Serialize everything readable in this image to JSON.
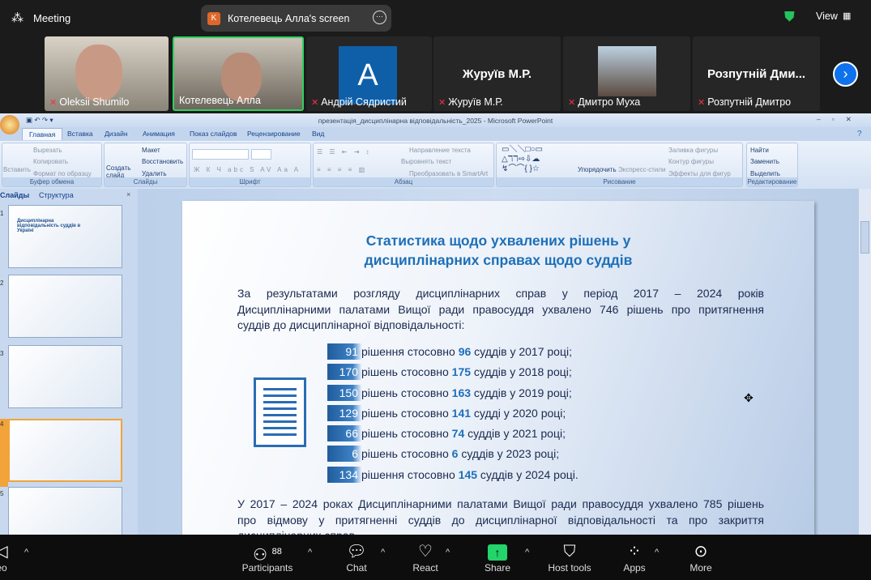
{
  "zoom": {
    "meeting_label": "Meeting",
    "share_pill": {
      "initial": "K",
      "label": "Котелевець Алла's screen"
    },
    "view_label": "View",
    "participants": [
      {
        "name": "Oleksii Shumilo",
        "video": true
      },
      {
        "name": "Котелевець Алла",
        "video": true,
        "active": true
      },
      {
        "name": "Андрій Сядристий",
        "avatar_letter": "A"
      },
      {
        "name": "Журуїв М.Р.",
        "display": "Журуїв М.Р."
      },
      {
        "name": "Дмитро Муха",
        "video": true
      },
      {
        "name": "Розпутній Дмитро",
        "display": "Розпутній Дми..."
      }
    ],
    "toolbar": {
      "video_label": "eo",
      "participants_label": "Participants",
      "participants_count": "88",
      "chat": "Chat",
      "react": "React",
      "share": "Share",
      "host_tools": "Host tools",
      "apps": "Apps",
      "more": "More"
    },
    "colors": {
      "share_green": "#22d46a",
      "accent_blue": "#0e72ed"
    }
  },
  "ppt": {
    "window_title": "презентація_дисциплінарна відповідальність_2025 - Microsoft PowerPoint",
    "tabs": [
      "Главная",
      "Вставка",
      "Дизайн",
      "Анимация",
      "Показ слайдов",
      "Рецензирование",
      "Вид"
    ],
    "ribbon": {
      "clipboard": {
        "label": "Буфер обмена",
        "paste": "Вставить",
        "cut": "Вырезать",
        "copy": "Копировать",
        "format": "Формат по образцу"
      },
      "slides": {
        "label": "Слайды",
        "new": "Создать слайд",
        "layout": "Макет",
        "reset": "Восстановить",
        "delete": "Удалить"
      },
      "font": {
        "label": "Шрифт"
      },
      "paragraph": {
        "label": "Абзац",
        "direction": "Направление текста",
        "align": "Выровнять текст",
        "smartart": "Преобразовать в SmartArt"
      },
      "drawing": {
        "label": "Рисование",
        "arrange": "Упорядочить",
        "styles": "Экспресс-стили",
        "fill": "Заливка фигуры",
        "outline": "Контур фигуры",
        "effects": "Эффекты для фигур"
      },
      "editing": {
        "label": "Редактирование",
        "find": "Найти",
        "replace": "Заменить",
        "select": "Выделить"
      }
    },
    "panel": {
      "tab_slides": "Слайды",
      "tab_outline": "Структура",
      "numbers": [
        "1",
        "2",
        "3",
        "4",
        "5"
      ],
      "thumb1_title": "Дисциплінарна відповідальність суддів в Україні"
    },
    "slide": {
      "title_line1": "Статистика щодо ухвалених рішень у",
      "title_line2": "дисциплінарних справах щодо суддів",
      "intro_lines": [
        "За результатами розгляду дисциплінарних справ у період 2017 – 2024 років",
        "Дисциплінарними палатами Вищої ради правосуддя ухвалено 746 рішень про притягнення",
        "суддів до дисциплінарної відповідальності:"
      ],
      "items": [
        {
          "count": "91",
          "pre": "рішення стосовно ",
          "judges": "96",
          "post": " суддів у 2017 році;"
        },
        {
          "count": "170",
          "pre": "рішень стосовно ",
          "judges": "175",
          "post": " суддів у 2018 році;"
        },
        {
          "count": "150",
          "pre": "рішень стосовно ",
          "judges": "163",
          "post": " суддів у 2019 році;"
        },
        {
          "count": "129",
          "pre": "рішень стосовно ",
          "judges": "141",
          "post": " судді у 2020 році;"
        },
        {
          "count": "66",
          "pre": "рішень стосовно ",
          "judges": "74",
          "post": " суддів у 2021 році;"
        },
        {
          "count": "6",
          "pre": "рішень стосовно ",
          "judges": "6",
          "post": " суддів у 2023 році;"
        },
        {
          "count": "134",
          "pre": "рішення стосовно ",
          "judges": "145",
          "post": " суддів у 2024 році."
        }
      ],
      "outro_lines": [
        "У 2017 – 2024 роках Дисциплінарними палатами Вищої ради правосуддя ухвалено 785 рішень",
        "про відмову у притягненні суддів до дисциплінарної відповідальності та про закриття",
        "дисциплінарних справ."
      ]
    }
  }
}
